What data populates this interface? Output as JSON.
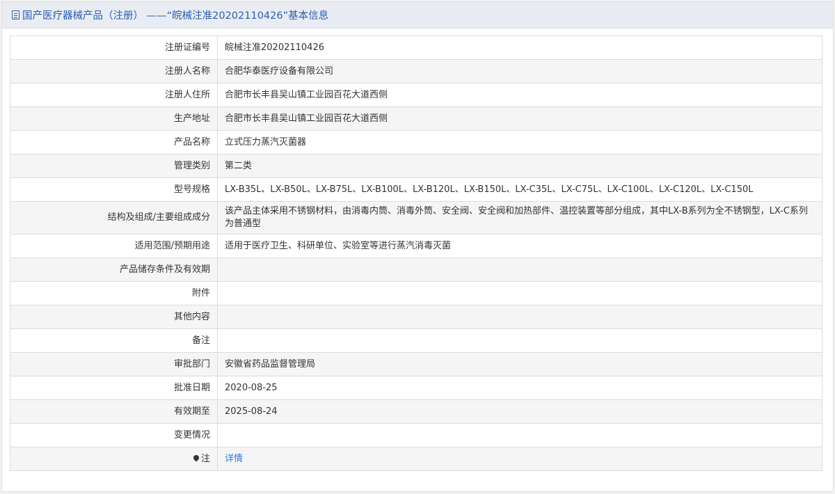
{
  "header": {
    "title": "国产医疗器械产品（注册） ——“皖械注准20202110426”基本信息"
  },
  "rows": [
    {
      "label": "注册证编号",
      "value": "皖械注准20202110426"
    },
    {
      "label": "注册人名称",
      "value": "合肥华泰医疗设备有限公司"
    },
    {
      "label": "注册人住所",
      "value": "合肥市长丰县吴山镇工业园百花大道西侧"
    },
    {
      "label": "生产地址",
      "value": "合肥市长丰县吴山镇工业园百花大道西侧"
    },
    {
      "label": "产品名称",
      "value": "立式压力蒸汽灭菌器"
    },
    {
      "label": "管理类别",
      "value": "第二类"
    },
    {
      "label": "型号规格",
      "value": "LX-B35L、LX-B50L、LX-B75L、LX-B100L、LX-B120L、LX-B150L、LX-C35L、LX-C75L、LX-C100L、LX-C120L、LX-C150L"
    },
    {
      "label": "结构及组成/主要组成成分",
      "value": "该产品主体采用不锈钢材料，由消毒内筒、消毒外筒、安全阀、安全阀和加热部件、温控装置等部分组成，其中LX-B系列为全不锈钢型，LX-C系列为普通型"
    },
    {
      "label": "适用范围/预期用途",
      "value": "适用于医疗卫生、科研单位、实验室等进行蒸汽消毒灭菌"
    },
    {
      "label": "产品储存条件及有效期",
      "value": ""
    },
    {
      "label": "附件",
      "value": ""
    },
    {
      "label": "其他内容",
      "value": ""
    },
    {
      "label": "备注",
      "value": ""
    },
    {
      "label": "审批部门",
      "value": "安徽省药品监督管理局"
    },
    {
      "label": "批准日期",
      "value": "2020-08-25"
    },
    {
      "label": "有效期至",
      "value": "2025-08-24"
    },
    {
      "label": "变更情况",
      "value": ""
    }
  ],
  "note_row": {
    "label": "注",
    "link": "详情",
    "icon": "pin-icon"
  }
}
